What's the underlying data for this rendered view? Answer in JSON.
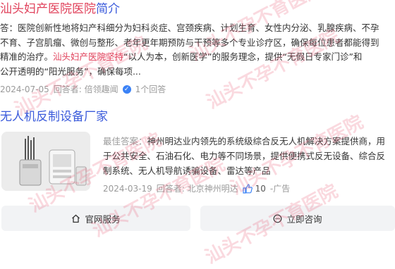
{
  "result1": {
    "title_part1": "汕头妇产医院医院",
    "title_part2": "简介",
    "lines": [
      "答：医院创新性地将妇产科细分为妇科炎症、宫颈疾病、计划生育、女性内分泌、乳腺疾病、不孕",
      "不育、子宫肌瘤、微创与整形、老年更年期预防与干预等多个专业诊疗区，确保每位患者都能得到",
      "精准的治疗。",
      "公开透明的“阳光服务”，确保每项..."
    ],
    "line3_highlight": "汕头妇产医院坚持",
    "line3_rest": "“以人为本，创新医学”的服务理念，提供“无假日专家门诊”和",
    "date": "2024-07-05",
    "answerer": "回答者: 倍领趣闻",
    "count": "1个回答"
  },
  "result2": {
    "title": "无人机反制设备厂家",
    "label": "最佳答案：",
    "lines": [
      "神州明达业内领先的系统级综合反无人机解决方案提供商，用",
      "于公共安全、石油石化、电力等不同场景，提供便携式反无设备、综合反",
      "制系统、无人机导航诱骗设备、雷达等产品"
    ],
    "date": "2024-03-19",
    "answerer": "回答者: 北京神州明达",
    "likes": "10",
    "ad": "-广告"
  },
  "buttons": {
    "official": "官网服务",
    "consult": "立即咨询"
  },
  "watermark": "汕头不孕不育医院",
  "icons": [
    "verified-icon",
    "thumbs-up-icon",
    "home-icon",
    "chat-icon"
  ],
  "colors": {
    "highlight": "#e0405a",
    "link": "#3b5bdb",
    "muted": "#9a9a9a"
  }
}
